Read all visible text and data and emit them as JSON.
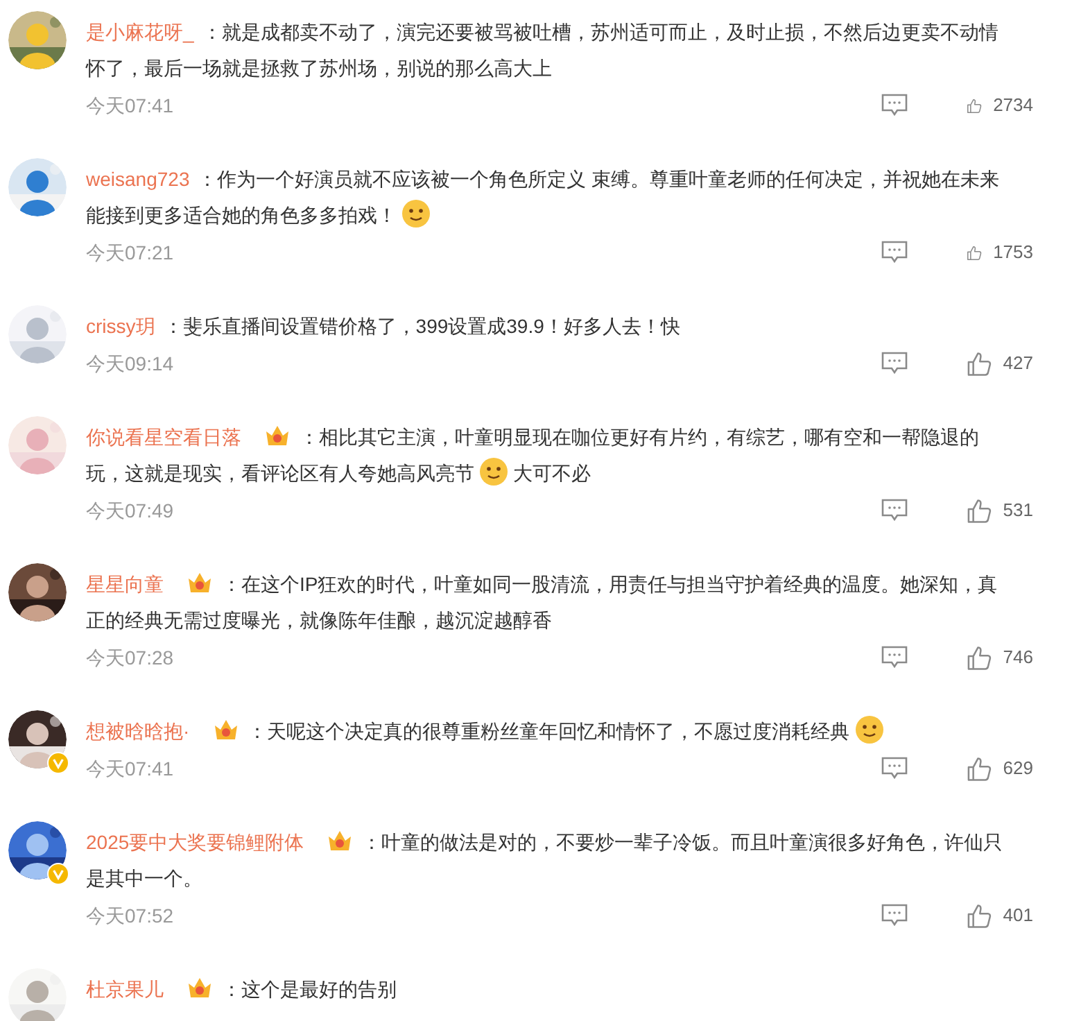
{
  "comments": [
    {
      "avatar": {
        "kind": "picture"
      },
      "name": "是小麻花呀_",
      "parts": [
        {
          "kind": "text",
          "text": "：就是成都卖不动了，演完还要被骂被吐槽，苏州适可而止，及时止损，不然后边更卖不动情怀了，最后一场就是拯救了苏州场，别说的那么高大上"
        }
      ],
      "time": "今天07:41",
      "likes": "2734"
    },
    {
      "avatar": {
        "kind": "picture"
      },
      "name": "weisang723",
      "parts": [
        {
          "kind": "text",
          "text": "：作为一个好演员就不应该被一个角色所定义 束缚。尊重叶童老师的任何决定，并祝她在未来能接到更多适合她的角色多多拍戏！"
        },
        {
          "kind": "emoji"
        }
      ],
      "time": "今天07:21",
      "likes": "1753"
    },
    {
      "avatar": {
        "kind": "picture"
      },
      "name": "crissy玥",
      "parts": [
        {
          "kind": "text",
          "text": "：斐乐直播间设置错价格了，399设置成39.9！好多人去！快"
        }
      ],
      "time": "今天09:14",
      "likes": "427"
    },
    {
      "avatar": {
        "kind": "picture"
      },
      "name": "你说看星空看日落",
      "badge": true,
      "parts": [
        {
          "kind": "text",
          "text": "：相比其它主演，叶童明显现在咖位更好有片约，有综艺，哪有空和一帮隐退的玩，这就是现实，看评论区有人夸她高风亮节"
        },
        {
          "kind": "emoji"
        },
        {
          "kind": "text",
          "text": "大可不必"
        }
      ],
      "time": "今天07:49",
      "likes": "531"
    },
    {
      "avatar": {
        "kind": "picture"
      },
      "name": "星星向童",
      "badge": true,
      "parts": [
        {
          "kind": "text",
          "text": "：在这个IP狂欢的时代，叶童如同一股清流，用责任与担当守护着经典的温度。她深知，真正的经典无需过度曝光，就像陈年佳酿，越沉淀越醇香"
        }
      ],
      "time": "今天07:28",
      "likes": "746"
    },
    {
      "avatar": {
        "kind": "picture",
        "verified": true
      },
      "name": "想被晗晗抱·",
      "badge": true,
      "parts": [
        {
          "kind": "text",
          "text": "：天呢这个决定真的很尊重粉丝童年回忆和情怀了，不愿过度消耗经典"
        },
        {
          "kind": "emoji"
        }
      ],
      "time": "今天07:41",
      "likes": "629"
    },
    {
      "avatar": {
        "kind": "picture",
        "verified": true
      },
      "name": "2025要中大奖要锦鲤附体",
      "badge": true,
      "parts": [
        {
          "kind": "text",
          "text": "：叶童的做法是对的，不要炒一辈子冷饭。而且叶童演很多好角色，许仙只是其中一个。"
        }
      ],
      "time": "今天07:52",
      "likes": "401"
    },
    {
      "avatar": {
        "kind": "picture"
      },
      "name": "杜京果儿",
      "badge": true,
      "parts": [
        {
          "kind": "text",
          "text": "：这个是最好的告别"
        }
      ]
    }
  ]
}
